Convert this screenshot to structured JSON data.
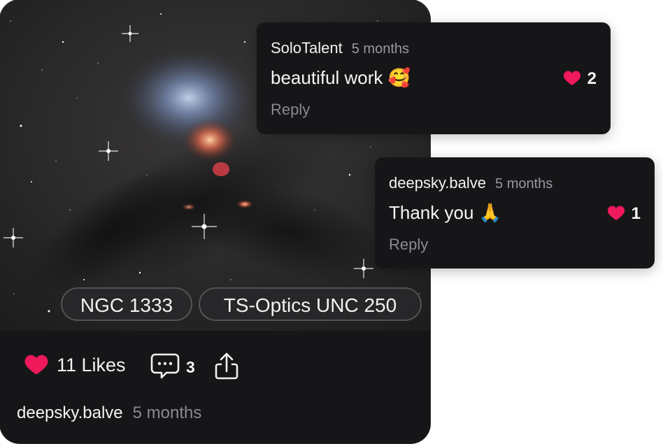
{
  "post": {
    "tags": [
      "NGC 1333",
      "TS-Optics UNC 250"
    ],
    "likes_label": "11 Likes",
    "comments_count": "3",
    "author": "deepsky.balve",
    "time": "5 months"
  },
  "comments": [
    {
      "user": "SoloTalent",
      "time": "5 months",
      "text": "beautiful work 🥰",
      "likes": "2",
      "reply_label": "Reply"
    },
    {
      "user": "deepsky.balve",
      "time": "5 months",
      "text": "Thank you 🙏",
      "likes": "1",
      "reply_label": "Reply"
    }
  ],
  "colors": {
    "heart": "#f0195c",
    "card_bg": "#161618",
    "muted_text": "#8b8b8f"
  },
  "icons": [
    "heart-icon",
    "comment-bubble-icon",
    "share-icon"
  ]
}
